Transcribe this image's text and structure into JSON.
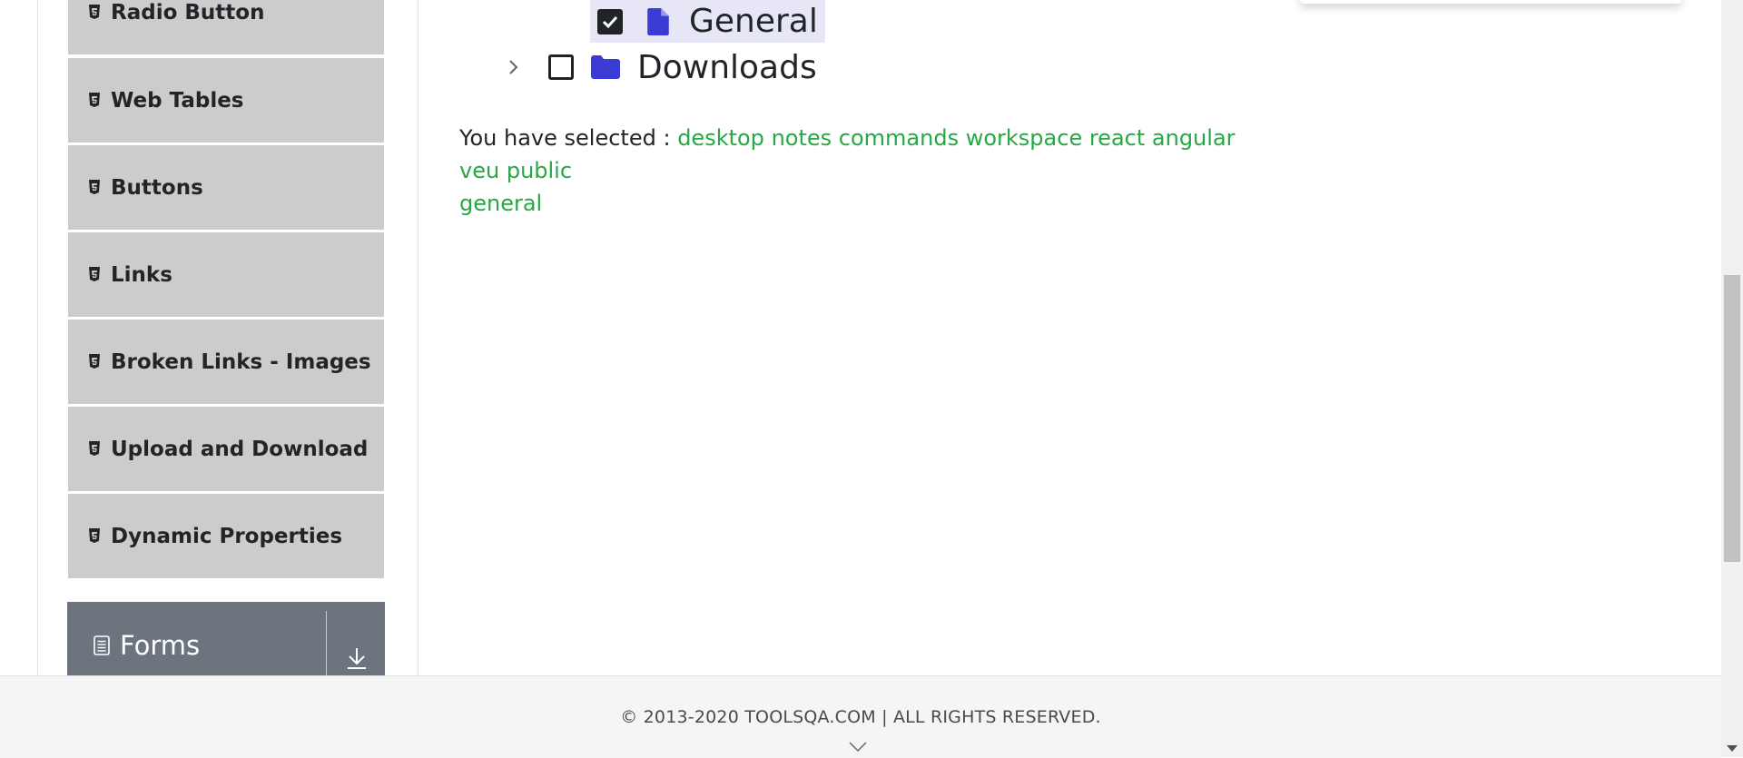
{
  "sidebar": {
    "items": [
      {
        "label": "Radio Button",
        "icon": "html5-icon"
      },
      {
        "label": "Web Tables",
        "icon": "html5-icon"
      },
      {
        "label": "Buttons",
        "icon": "html5-icon"
      },
      {
        "label": "Links",
        "icon": "html5-icon"
      },
      {
        "label": "Broken Links - Images",
        "icon": "html5-icon"
      },
      {
        "label": "Upload and Download",
        "icon": "html5-icon"
      },
      {
        "label": "Dynamic Properties",
        "icon": "html5-icon"
      }
    ],
    "group": {
      "label": "Forms",
      "icon": "document-icon",
      "toggle_icon": "download-arrow-icon"
    }
  },
  "tree": {
    "general": {
      "label": "General",
      "checked": true,
      "icon": "file-icon"
    },
    "downloads": {
      "label": "Downloads",
      "checked": false,
      "icon": "folder-icon",
      "expand_icon": "chevron-right-icon"
    }
  },
  "result": {
    "prefix": "You have selected :",
    "items": [
      "desktop",
      "notes",
      "commands",
      "workspace",
      "react",
      "angular",
      "veu",
      "public",
      "general"
    ]
  },
  "footer": {
    "copyright": "© 2013-2020 TOOLSQA.COM | ALL RIGHTS RESERVED."
  },
  "colors": {
    "sidebar_item_bg": "#cccccc",
    "group_header_bg": "#6c757d",
    "selected_text": "#28a745",
    "tree_icon": "#3b3bd6",
    "highlight_bg": "#e6e6f7"
  }
}
